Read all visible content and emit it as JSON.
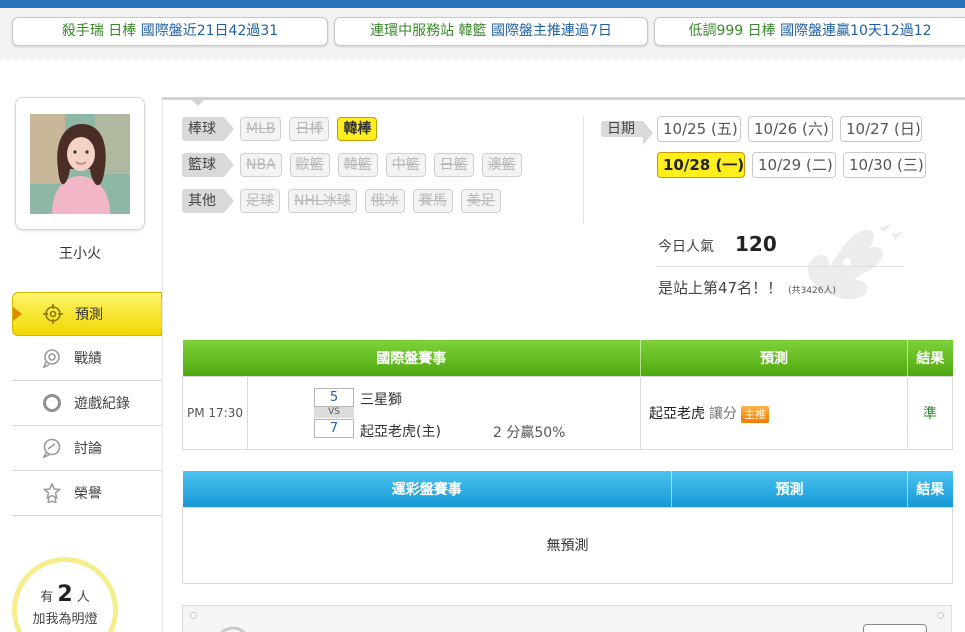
{
  "tickers": [
    {
      "name": "殺手瑞",
      "league": "日棒",
      "record": "國際盤近21日42過31"
    },
    {
      "name": "連環中服務站",
      "league": "韓籃",
      "record": "國際盤主推連過7日"
    },
    {
      "name": "低調999",
      "league": "日棒",
      "record": "國際盤連贏10天12過12"
    }
  ],
  "profile": {
    "username": "王小火"
  },
  "menu": [
    {
      "label": "預測",
      "icon": "target-icon"
    },
    {
      "label": "戰績",
      "icon": "record-icon"
    },
    {
      "label": "遊戲紀錄",
      "icon": "ring-icon"
    },
    {
      "label": "討論",
      "icon": "chat-icon"
    },
    {
      "label": "榮譽",
      "icon": "medal-icon"
    }
  ],
  "fans": {
    "prefix": "有",
    "count": "2",
    "suffix": "人",
    "text": "加我為明燈"
  },
  "categories": {
    "baseball": {
      "label": "棒球",
      "items": [
        "MLB",
        "日棒",
        "韓棒"
      ]
    },
    "basketball": {
      "label": "籃球",
      "items": [
        "NBA",
        "歐籃",
        "韓籃",
        "中籃",
        "日籃",
        "澳籃"
      ]
    },
    "other": {
      "label": "其他",
      "items": [
        "足球",
        "NHL冰球",
        "俄冰",
        "賽馬",
        "美足"
      ]
    }
  },
  "dates": {
    "label": "日期",
    "items": [
      "10/25 (五)",
      "10/26 (六)",
      "10/27 (日)",
      "10/28 (一)",
      "10/29 (二)",
      "10/30 (三)"
    ],
    "selected": "10/28 (一)"
  },
  "popularity": {
    "label": "今日人氣",
    "value": "120",
    "rank": "是站上第47名！！",
    "total": "(共3426人)"
  },
  "intl_table": {
    "headers": [
      "國際盤賽事",
      "預測",
      "結果"
    ],
    "rows": [
      {
        "time": "PM 17:30",
        "away_score": "5",
        "vs": "VS",
        "home_score": "7",
        "away_team": "三星獅",
        "home_team": "起亞老虎(主)",
        "odds": "2 分贏50%",
        "pick_team": "起亞老虎",
        "pick_type": "讓分",
        "badge": "主推",
        "result": "準"
      }
    ]
  },
  "lottery_table": {
    "headers": [
      "運彩盤賽事",
      "預測",
      "結果"
    ],
    "empty": "無預測"
  },
  "colors": {
    "green_header": "#5cb817",
    "blue_header": "#1fa3dd",
    "highlight": "#ffee1e",
    "top_bar": "#2b73b8"
  }
}
